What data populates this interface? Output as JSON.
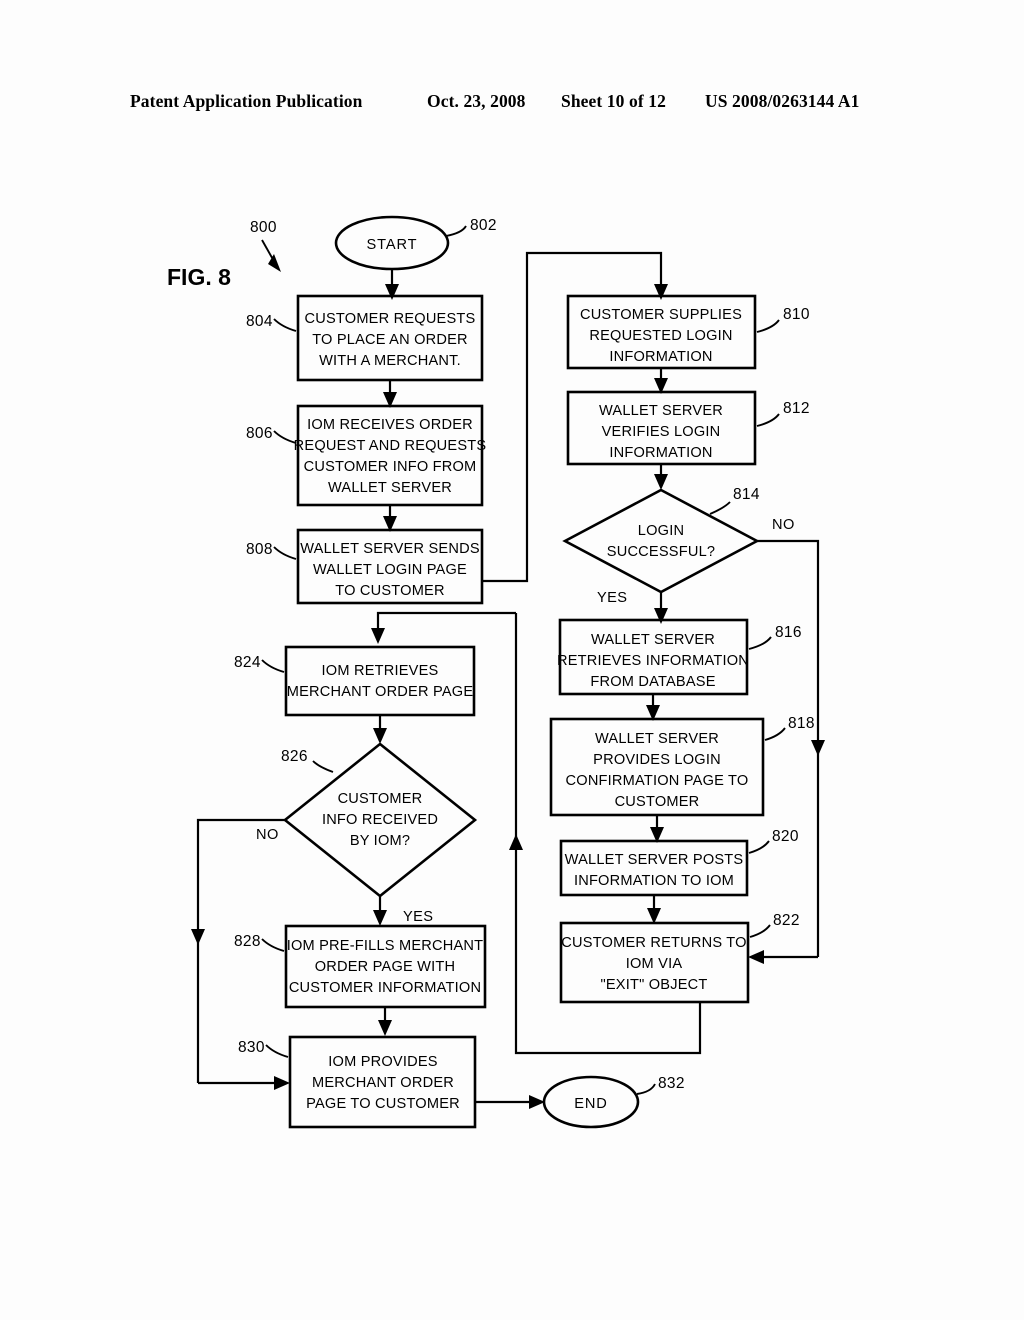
{
  "header": {
    "publication": "Patent Application Publication",
    "date": "Oct. 23, 2008",
    "sheet": "Sheet 10 of 12",
    "patent_number": "US 2008/0263144 A1"
  },
  "figure": {
    "label": "FIG. 8",
    "diagram_ref": "800"
  },
  "nodes": {
    "start": {
      "ref": "802",
      "text": "START"
    },
    "n804": {
      "ref": "804",
      "lines": [
        "CUSTOMER REQUESTS",
        "TO PLACE AN ORDER",
        "WITH A MERCHANT."
      ]
    },
    "n806": {
      "ref": "806",
      "lines": [
        "IOM RECEIVES ORDER",
        "REQUEST AND REQUESTS",
        "CUSTOMER INFO FROM",
        "WALLET SERVER"
      ]
    },
    "n808": {
      "ref": "808",
      "lines": [
        "WALLET SERVER SENDS",
        "WALLET LOGIN PAGE",
        "TO CUSTOMER"
      ]
    },
    "n810": {
      "ref": "810",
      "lines": [
        "CUSTOMER SUPPLIES",
        "REQUESTED  LOGIN",
        "INFORMATION"
      ]
    },
    "n812": {
      "ref": "812",
      "lines": [
        "WALLET SERVER",
        "VERIFIES LOGIN",
        "INFORMATION"
      ]
    },
    "n814": {
      "ref": "814",
      "lines": [
        "LOGIN",
        "SUCCESSFUL?"
      ],
      "yes": "YES",
      "no": "NO"
    },
    "n816": {
      "ref": "816",
      "lines": [
        "WALLET SERVER",
        "RETRIEVES INFORMATION",
        "FROM DATABASE"
      ]
    },
    "n818": {
      "ref": "818",
      "lines": [
        "WALLET SERVER",
        "PROVIDES LOGIN",
        "CONFIRMATION PAGE TO",
        "CUSTOMER"
      ]
    },
    "n820": {
      "ref": "820",
      "lines": [
        "WALLET SERVER POSTS",
        "INFORMATION TO IOM"
      ]
    },
    "n822": {
      "ref": "822",
      "lines": [
        "CUSTOMER RETURNS TO",
        "IOM VIA",
        "\"EXIT\" OBJECT"
      ]
    },
    "n824": {
      "ref": "824",
      "lines": [
        "IOM RETRIEVES",
        "MERCHANT ORDER PAGE"
      ]
    },
    "n826": {
      "ref": "826",
      "lines": [
        "CUSTOMER",
        "INFO RECEIVED",
        "BY IOM?"
      ],
      "yes": "YES",
      "no": "NO"
    },
    "n828": {
      "ref": "828",
      "lines": [
        "IOM PRE-FILLS MERCHANT",
        "ORDER PAGE WITH",
        "CUSTOMER INFORMATION"
      ]
    },
    "n830": {
      "ref": "830",
      "lines": [
        "IOM PROVIDES",
        "MERCHANT ORDER",
        "PAGE TO CUSTOMER"
      ]
    },
    "end": {
      "ref": "832",
      "text": "END"
    }
  },
  "colors": {
    "ink": "#000000",
    "paper": "#fdfdfd"
  }
}
